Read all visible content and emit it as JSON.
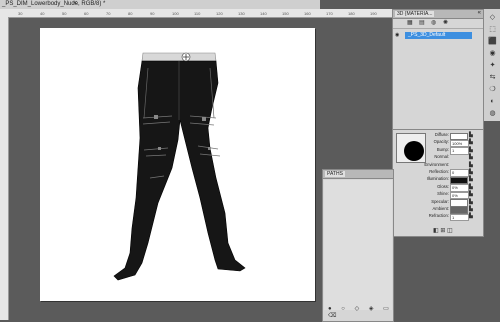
{
  "document": {
    "tab_title": "_PS_DIM_Lowerbody_Nude, RGB/8) *",
    "close_glyph": "×"
  },
  "ruler": {
    "ticks": [
      "30",
      "40",
      "50",
      "60",
      "70",
      "80",
      "90",
      "100",
      "110",
      "120",
      "130",
      "140",
      "150",
      "160",
      "170",
      "180",
      "190"
    ]
  },
  "panel_3d": {
    "tab_label": "3D {MATERIA...",
    "collapse_glyph": "«",
    "menu_glyph": "≡",
    "icons": [
      "scene-icon",
      "mesh-icon",
      "materials-icon",
      "lights-icon"
    ],
    "material_item": "_PS_3D_Default",
    "eye_glyph": "👁"
  },
  "material_props": {
    "rows": [
      {
        "label": "Diffuse:",
        "value": ""
      },
      {
        "label": "Opacity:",
        "value": "100%"
      },
      {
        "label": "Bump:",
        "value": "1"
      },
      {
        "label": "Normal:",
        "value": ""
      },
      {
        "label": "Environment:",
        "value": ""
      },
      {
        "label": "Reflection:",
        "value": "0"
      },
      {
        "label": "Illumination:",
        "value": ""
      },
      {
        "label": "Gloss:",
        "value": "0%"
      },
      {
        "label": "Shine:",
        "value": "0%"
      },
      {
        "label": "Specular:",
        "value": ""
      },
      {
        "label": "Ambient:",
        "value": ""
      },
      {
        "label": "Refraction:",
        "value": "1"
      }
    ],
    "footer_icons": "◧ ⊞ ◫"
  },
  "paths_panel": {
    "tab_label": "PATHS",
    "footer_icons": "● ○ ◇ ◈ ▭ ⌫"
  },
  "tools": {
    "items": [
      "◇",
      "⬚",
      "⬛",
      "◉",
      "✦",
      "⇆",
      "❍",
      "◐",
      "◍"
    ]
  },
  "colors": {
    "selection_blue": "#3d8fe0",
    "canvas_gray": "#5b5b5b",
    "panel_gray": "#d6d6d6"
  }
}
